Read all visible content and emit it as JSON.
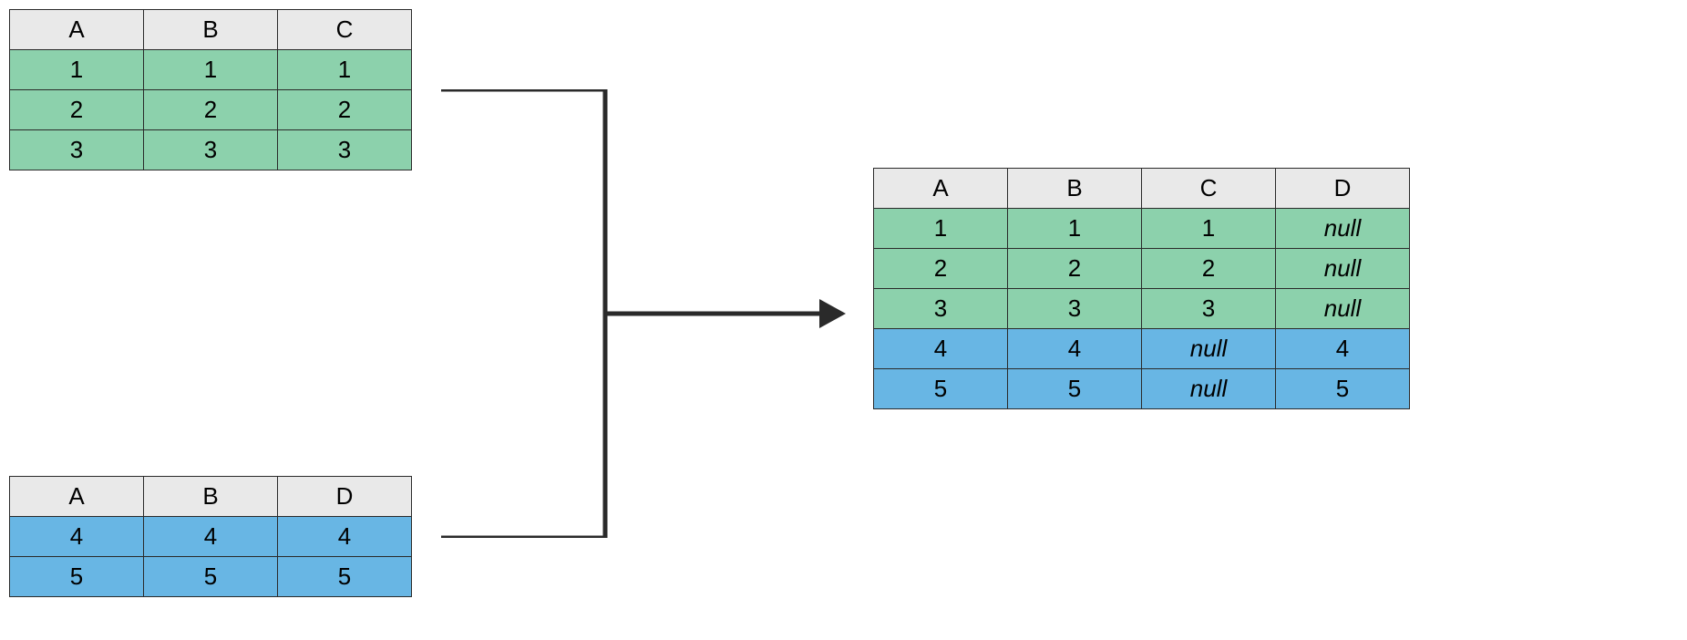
{
  "colors": {
    "header_bg": "#e9e9e9",
    "green_row": "#8cd1ac",
    "blue_row": "#68b6e4",
    "border": "#2a2a2a",
    "arrow": "#2a2a2a"
  },
  "table1": {
    "headers": [
      "A",
      "B",
      "C"
    ],
    "rows": [
      {
        "color": "green",
        "cells": [
          "1",
          "1",
          "1"
        ]
      },
      {
        "color": "green",
        "cells": [
          "2",
          "2",
          "2"
        ]
      },
      {
        "color": "green",
        "cells": [
          "3",
          "3",
          "3"
        ]
      }
    ]
  },
  "table2": {
    "headers": [
      "A",
      "B",
      "D"
    ],
    "rows": [
      {
        "color": "blue",
        "cells": [
          "4",
          "4",
          "4"
        ]
      },
      {
        "color": "blue",
        "cells": [
          "5",
          "5",
          "5"
        ]
      }
    ]
  },
  "table3": {
    "headers": [
      "A",
      "B",
      "C",
      "D"
    ],
    "rows": [
      {
        "color": "green",
        "cells": [
          "1",
          "1",
          "1",
          {
            "v": "null",
            "italic": true
          }
        ]
      },
      {
        "color": "green",
        "cells": [
          "2",
          "2",
          "2",
          {
            "v": "null",
            "italic": true
          }
        ]
      },
      {
        "color": "green",
        "cells": [
          "3",
          "3",
          "3",
          {
            "v": "null",
            "italic": true
          }
        ]
      },
      {
        "color": "blue",
        "cells": [
          "4",
          "4",
          {
            "v": "null",
            "italic": true
          },
          "4"
        ]
      },
      {
        "color": "blue",
        "cells": [
          "5",
          "5",
          {
            "v": "null",
            "italic": true
          },
          "5"
        ]
      }
    ]
  },
  "chart_data": {
    "type": "table",
    "description": "Diagram showing vertical concatenation / union of two tables into a combined result with null-filled missing columns",
    "inputs": [
      {
        "name": "table1",
        "columns": [
          "A",
          "B",
          "C"
        ],
        "rows": [
          [
            1,
            1,
            1
          ],
          [
            2,
            2,
            2
          ],
          [
            3,
            3,
            3
          ]
        ],
        "row_color": "green"
      },
      {
        "name": "table2",
        "columns": [
          "A",
          "B",
          "D"
        ],
        "rows": [
          [
            4,
            4,
            4
          ],
          [
            5,
            5,
            5
          ]
        ],
        "row_color": "blue"
      }
    ],
    "output": {
      "name": "result",
      "columns": [
        "A",
        "B",
        "C",
        "D"
      ],
      "rows": [
        {
          "values": [
            1,
            1,
            1,
            null
          ],
          "source": "table1",
          "color": "green"
        },
        {
          "values": [
            2,
            2,
            2,
            null
          ],
          "source": "table1",
          "color": "green"
        },
        {
          "values": [
            3,
            3,
            3,
            null
          ],
          "source": "table1",
          "color": "green"
        },
        {
          "values": [
            4,
            4,
            null,
            4
          ],
          "source": "table2",
          "color": "blue"
        },
        {
          "values": [
            5,
            5,
            null,
            5
          ],
          "source": "table2",
          "color": "blue"
        }
      ]
    }
  }
}
